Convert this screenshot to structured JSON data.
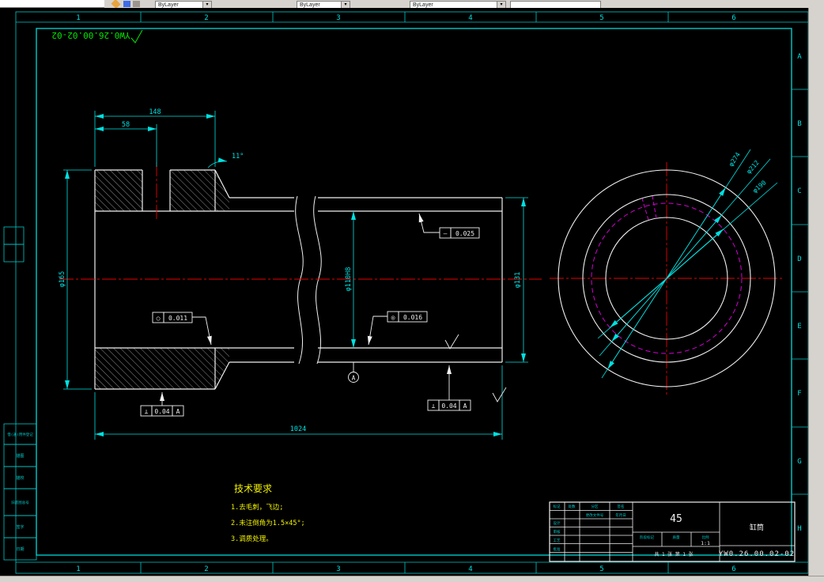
{
  "toolbar": {
    "combo1": "ByLayer",
    "combo2": "ByLayer",
    "combo3": "ByLayer",
    "field": ""
  },
  "border": {
    "zones_h": [
      "1",
      "2",
      "3",
      "4",
      "5",
      "6"
    ],
    "zones_v": [
      "A",
      "B",
      "C",
      "D",
      "E",
      "F",
      "G",
      "H"
    ]
  },
  "stamp": {
    "code": "YW0.26.00.02-02"
  },
  "main_view": {
    "dim_width_outer": "148",
    "dim_width_inner": "58",
    "dim_angle": "11°",
    "dim_od_left": "φ165",
    "dim_od_right": "φ131",
    "dim_bore": "φ110H8",
    "dim_total": "1024",
    "gdt_straightness": {
      "symbol": "—",
      "value": "0.025"
    },
    "gdt_roundness": {
      "symbol": "○",
      "value": "0.011"
    },
    "gdt_concentricity": {
      "symbol": "◎",
      "value": "0.016"
    },
    "gdt_perp_left": {
      "symbol": "⊥",
      "value": "0.04",
      "datum": "A"
    },
    "gdt_perp_right": {
      "symbol": "⊥",
      "value": "0.04",
      "datum": "A"
    },
    "datum_label": "A"
  },
  "end_view": {
    "dim_outer": "φ274",
    "dim_mid": "φ212",
    "dim_inner": "φ190"
  },
  "tech_req": {
    "title": "技术要求",
    "item1": "1.去毛刺，飞边;",
    "item2": "2.未注倒角为1.5×45°;",
    "item3": "3.调质处理。"
  },
  "title_block": {
    "material": "45",
    "part_name": "缸筒",
    "drawing_no": "YW0.26.00.02-02",
    "scale": "1:1",
    "col_marks": "标记",
    "col_count": "处数",
    "col_zone": "分区",
    "col_doc": "更改文件号",
    "col_sign": "签名",
    "col_date": "年月日",
    "row_design": "设计",
    "row_check": "审核",
    "row_process": "工艺",
    "row_approve": "批准",
    "lbl_stage": "阶段标记",
    "lbl_weight": "质量",
    "lbl_scale": "比例",
    "sheet": "共 1 张 第 1 张"
  },
  "side_blocks": {
    "b1": "借(通)用件登记",
    "b2": "描图",
    "b3": "描校",
    "b4": "旧底图总号",
    "b5": "签字",
    "b6": "日期"
  }
}
